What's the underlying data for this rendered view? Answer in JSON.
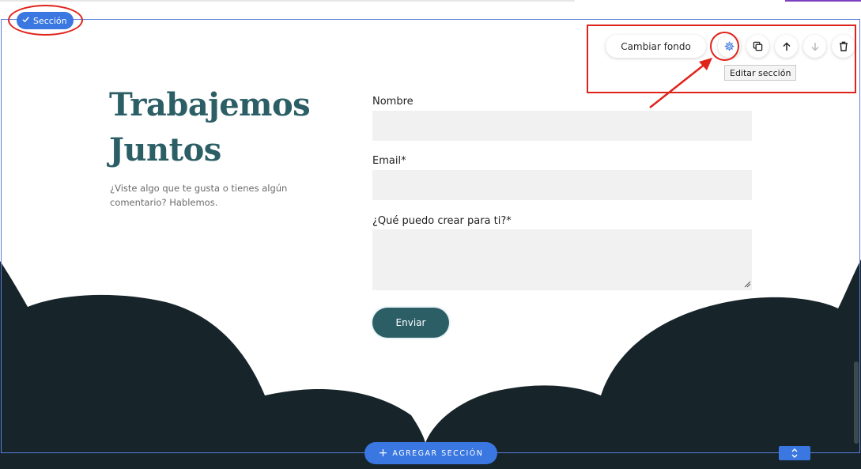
{
  "editor": {
    "section_chip": {
      "label": "Sección",
      "icon": "check-icon"
    },
    "toolbar": {
      "change_background_label": "Cambiar fondo",
      "buttons": [
        {
          "name": "settings",
          "icon": "gear-icon"
        },
        {
          "name": "duplicate",
          "icon": "copy-icon"
        },
        {
          "name": "move-up",
          "icon": "arrow-up-icon"
        },
        {
          "name": "move-down",
          "icon": "arrow-down-icon",
          "disabled": true
        },
        {
          "name": "delete",
          "icon": "trash-icon"
        }
      ],
      "tooltip": "Editar sección"
    },
    "add_section_label": "AGREGAR SECCIÓN",
    "add_section_icon": "plus-icon",
    "move_handle_icon": "chevron-up-down-icon"
  },
  "content": {
    "title_line1": "Trabajemos",
    "title_line2": "Juntos",
    "subtitle": "¿Viste algo que te gusta o tienes algún comentario? Hablemos.",
    "form": {
      "fields": [
        {
          "label": "Nombre",
          "value": ""
        },
        {
          "label": "Email*",
          "value": ""
        },
        {
          "label": "¿Qué puedo crear para ti?*",
          "value": ""
        }
      ],
      "submit_label": "Enviar"
    }
  },
  "colors": {
    "accent_blue": "#3a77e0",
    "title_teal": "#2c5e66",
    "dark_background": "#17242a",
    "annotation_red": "#e0231a"
  }
}
